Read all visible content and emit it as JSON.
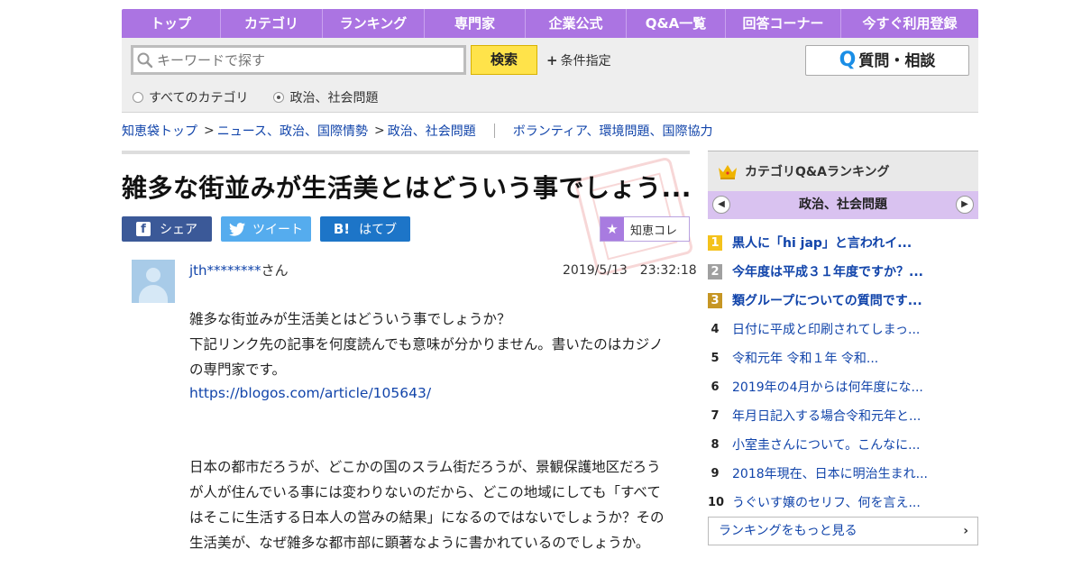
{
  "nav": {
    "items": [
      "トップ",
      "カテゴリ",
      "ランキング",
      "専門家",
      "企業公式",
      "Q&A一覧",
      "回答コーナー",
      "今すぐ利用登録"
    ]
  },
  "search": {
    "placeholder": "キーワードで探す",
    "button_label": "検索",
    "condition_label": "条件指定",
    "ask_label": "質問・相談",
    "radio_all": "すべてのカテゴリ",
    "radio_current": "政治、社会問題"
  },
  "breadcrumb": {
    "items": [
      "知恵袋トップ",
      "ニュース、政治、国際情勢",
      "政治、社会問題"
    ],
    "sep": ">",
    "related": "ボランティア、環境問題、国際協力"
  },
  "question": {
    "title": "雑多な街並みが生活美とはどういう事でしょう...",
    "share_fb": "シェア",
    "share_tw": "ツイート",
    "share_hb": "はてブ",
    "collect_label": "知恵コレ",
    "user_name": "jth********",
    "user_suffix": "さん",
    "date": "2019/5/13　23:32:18",
    "line1": "雑多な街並みが生活美とはどういう事でしょうか？",
    "line2": "下記リンク先の記事を何度読んでも意味が分かりません。書いたのはカジノの専門家です。",
    "link": "https://blogos.com/article/105643/",
    "para2": "日本の都市だろうが、どこかの国のスラム街だろうが、景観保護地区だろうが人が住んでいる事には変わりないのだから、どこの地域にしても「すべてはそこに生活する日本人の営みの結果」になるのではないでしょうか？その生活美が、なぜ雑多な都市部に顕著なように書かれているのでしょうか。"
  },
  "ranking": {
    "head": "カテゴリQ&Aランキング",
    "category": "政治、社会問題",
    "items": [
      {
        "num": "1",
        "text": "黒人に「hi jap」と言われイ..."
      },
      {
        "num": "2",
        "text": "今年度は平成３１年度ですか？..."
      },
      {
        "num": "3",
        "text": "類グループについての質問です..."
      },
      {
        "num": "4",
        "text": "日付に平成と印刷されてしまっ..."
      },
      {
        "num": "5",
        "text": "令和元年 令和１年 令和..."
      },
      {
        "num": "6",
        "text": "2019年の4月からは何年度にな..."
      },
      {
        "num": "7",
        "text": "年月日記入する場合令和元年と..."
      },
      {
        "num": "8",
        "text": "小室圭さんについて。こんなに..."
      },
      {
        "num": "9",
        "text": "2018年現在、日本に明治生まれ..."
      },
      {
        "num": "10",
        "text": "うぐいす嬢のセリフ、何を言え..."
      }
    ],
    "more_label": "ランキングをもっと見る"
  },
  "colors": {
    "nav_bg": "#ab74e2",
    "search_btn": "#ffe34a",
    "link": "#1144aa",
    "rank_cat_bg": "#d9c2f0"
  }
}
